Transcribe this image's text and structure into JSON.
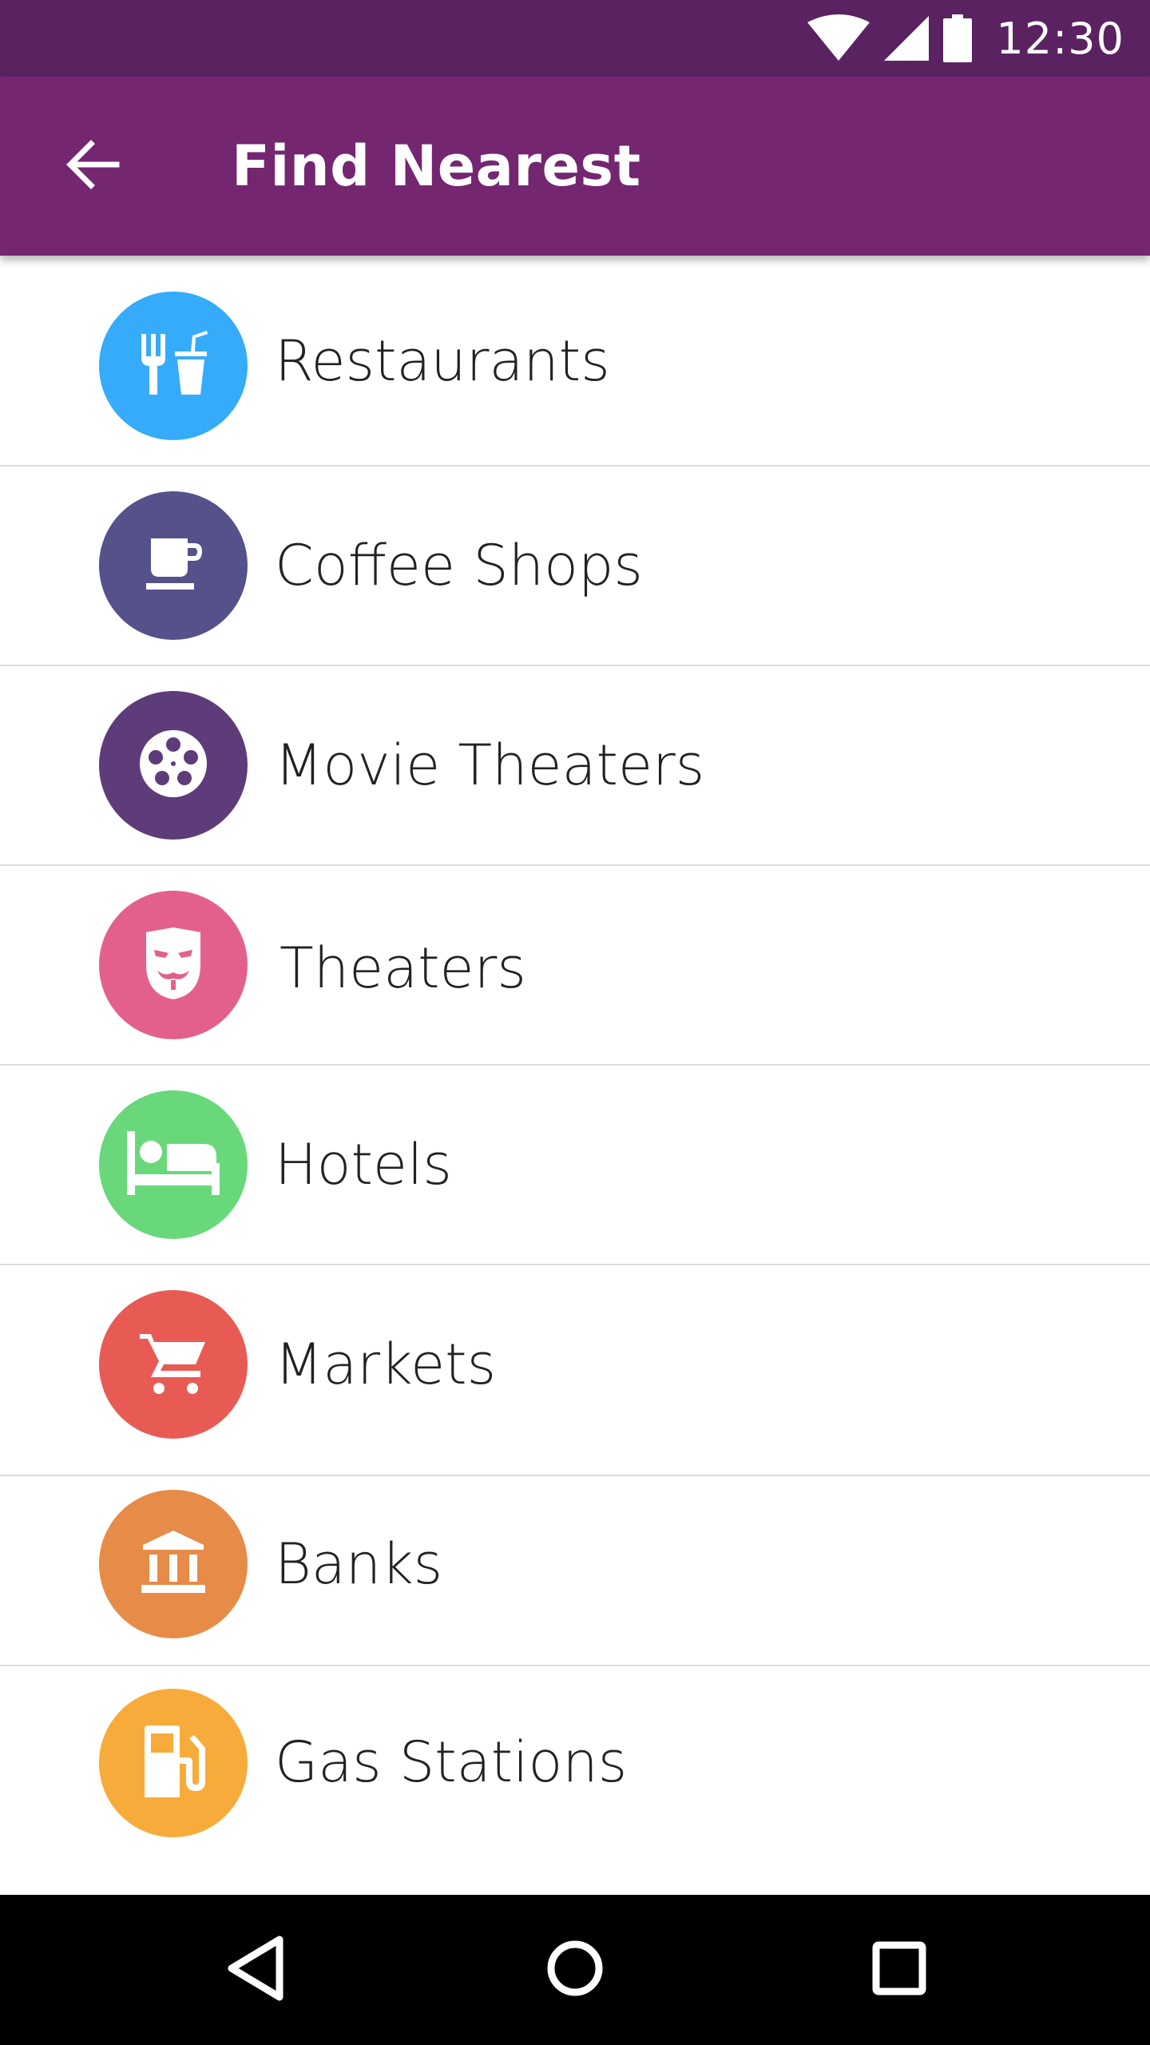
{
  "status_bar": {
    "time": "12:30",
    "icons": [
      "wifi-icon",
      "cell-signal-icon",
      "battery-icon"
    ],
    "color": "#5a2260"
  },
  "app_bar": {
    "title": "Find Nearest",
    "back_icon": "arrow-back-icon",
    "color": "#742671"
  },
  "categories": [
    {
      "label": "Restaurants",
      "icon": "fork-cup-icon",
      "color": "#35abf9"
    },
    {
      "label": "Coffee Shops",
      "icon": "coffee-cup-icon",
      "color": "#55518b"
    },
    {
      "label": "Movie Theaters",
      "icon": "film-reel-icon",
      "color": "#5e3b79"
    },
    {
      "label": "Theaters",
      "icon": "theater-mask-icon",
      "color": "#e3608d"
    },
    {
      "label": "Hotels",
      "icon": "bed-icon",
      "color": "#69d87a"
    },
    {
      "label": "Markets",
      "icon": "shopping-cart-icon",
      "color": "#e75b54"
    },
    {
      "label": "Banks",
      "icon": "bank-icon",
      "color": "#e78b48"
    },
    {
      "label": "Gas Stations",
      "icon": "gas-pump-icon",
      "color": "#f7ab3a"
    }
  ],
  "nav_bar": {
    "buttons": [
      "back-triangle-icon",
      "home-circle-icon",
      "recents-square-icon"
    ]
  }
}
